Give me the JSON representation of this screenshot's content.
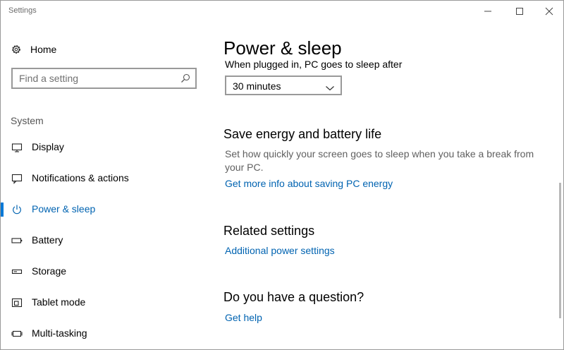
{
  "window": {
    "title": "Settings"
  },
  "sidebar": {
    "home_label": "Home",
    "search_placeholder": "Find a setting",
    "section_label": "System",
    "items": [
      {
        "label": "Display",
        "icon": "monitor-icon",
        "active": false
      },
      {
        "label": "Notifications & actions",
        "icon": "notification-icon",
        "active": false
      },
      {
        "label": "Power & sleep",
        "icon": "power-icon",
        "active": true
      },
      {
        "label": "Battery",
        "icon": "battery-icon",
        "active": false
      },
      {
        "label": "Storage",
        "icon": "storage-icon",
        "active": false
      },
      {
        "label": "Tablet mode",
        "icon": "tablet-mode-icon",
        "active": false
      },
      {
        "label": "Multi-tasking",
        "icon": "multitasking-icon",
        "active": false
      }
    ]
  },
  "main": {
    "title": "Power & sleep",
    "sleep_label": "When plugged in, PC goes to sleep after",
    "sleep_value": "30 minutes",
    "save_energy": {
      "heading": "Save energy and battery life",
      "description": "Set how quickly your screen goes to sleep when you take a break from your PC.",
      "link": "Get more info about saving PC energy"
    },
    "related": {
      "heading": "Related settings",
      "link": "Additional power settings"
    },
    "question": {
      "heading": "Do you have a question?",
      "link": "Get help"
    }
  },
  "colors": {
    "accent": "#0078d7",
    "link": "#0063b1"
  }
}
